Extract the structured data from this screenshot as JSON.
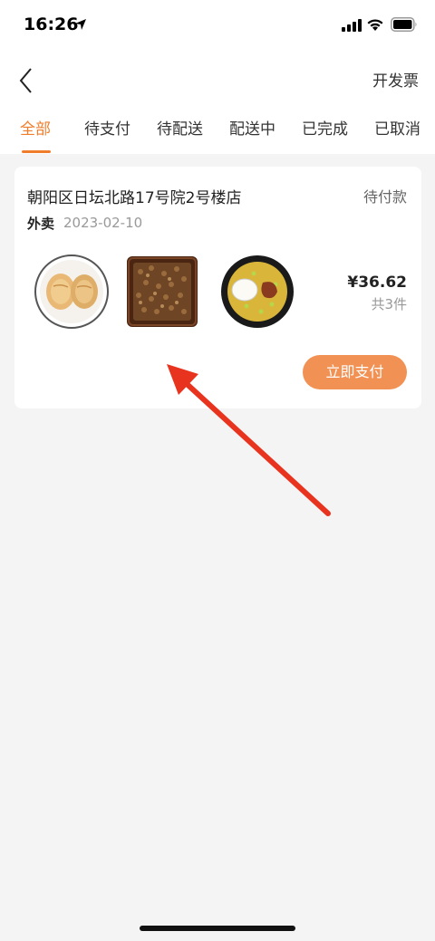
{
  "status_bar": {
    "time": "16:26"
  },
  "header": {
    "invoice_label": "开发票"
  },
  "tabs": [
    {
      "label": "全部",
      "active": true
    },
    {
      "label": "待支付",
      "active": false
    },
    {
      "label": "待配送",
      "active": false
    },
    {
      "label": "配送中",
      "active": false
    },
    {
      "label": "已完成",
      "active": false
    },
    {
      "label": "已取消",
      "active": false
    }
  ],
  "order": {
    "store_name": "朝阳区日坛北路17号院2号楼店",
    "status": "待付款",
    "type": "外卖",
    "date": "2023-02-10",
    "price": "¥36.62",
    "count": "共3件",
    "pay_button": "立即支付"
  },
  "colors": {
    "accent": "#f07d2c",
    "pay_button": "#f29154",
    "annotation_arrow": "#e8341f"
  }
}
